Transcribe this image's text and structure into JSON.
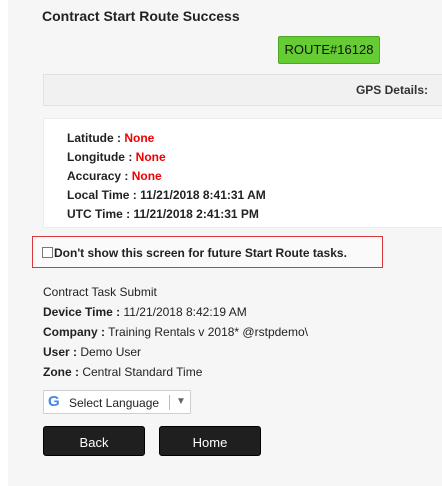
{
  "page": {
    "title": "Contract  Start Route Success",
    "route_badge": "ROUTE#16128"
  },
  "gps": {
    "header": "GPS Details:",
    "latitude_label": "Latitude : ",
    "latitude_value": "None",
    "longitude_label": "Longitude : ",
    "longitude_value": "None",
    "accuracy_label": "Accuracy : ",
    "accuracy_value": "None",
    "local_time": "Local Time : 11/21/2018 8:41:31 AM",
    "utc_time": "UTC Time : 11/21/2018 2:41:31 PM"
  },
  "options": {
    "dont_show_label": "Don't show this screen for future Start Route tasks.",
    "dont_show_checked": false
  },
  "info": {
    "heading": "Contract Task Submit",
    "device_time_label": "Device Time :",
    "device_time_value": " 11/21/2018 8:42:19 AM",
    "company_label": "Company :",
    "company_value": " Training Rentals v 2018* @rstpdemo\\",
    "user_label": "User :",
    "user_value": " Demo User",
    "zone_label": "Zone :",
    "zone_value": " Central Standard Time"
  },
  "language": {
    "label": "Select Language",
    "icon": "google-g-icon",
    "caret": "▼"
  },
  "buttons": {
    "back": "Back",
    "home": "Home"
  },
  "colors": {
    "route_badge": "#66cc33",
    "gps_none": "#ee0000",
    "highlight_border": "#d9363e",
    "button_bg": "#1f1f1f"
  }
}
